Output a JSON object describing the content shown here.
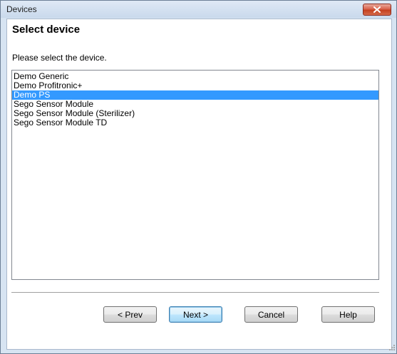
{
  "window": {
    "title": "Devices",
    "close_icon": "close-x-icon"
  },
  "page": {
    "heading": "Select device",
    "prompt": "Please select the device."
  },
  "devices": {
    "selected_index": 2,
    "items": [
      "Demo Generic",
      "Demo Profitronic+",
      "Demo PS",
      "Sego Sensor Module",
      "Sego Sensor Module (Sterilizer)",
      "Sego Sensor Module TD"
    ]
  },
  "buttons": {
    "prev": "< Prev",
    "next": "Next >",
    "cancel": "Cancel",
    "help": "Help"
  },
  "colors": {
    "selection": "#3399ff",
    "close_button": "#c4401f"
  }
}
